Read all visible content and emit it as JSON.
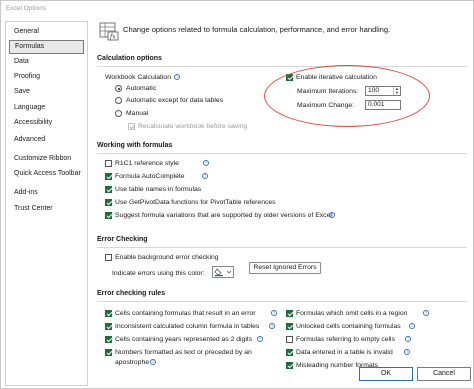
{
  "window": {
    "title": "Excel Options"
  },
  "sidebar": {
    "items": [
      {
        "label": "General"
      },
      {
        "label": "Formulas"
      },
      {
        "label": "Data"
      },
      {
        "label": "Proofing"
      },
      {
        "label": "Save"
      },
      {
        "label": "Language"
      },
      {
        "label": "Accessibility"
      },
      {
        "label": "Advanced"
      },
      {
        "label": "Customize Ribbon"
      },
      {
        "label": "Quick Access Toolbar"
      },
      {
        "label": "Add-ins"
      },
      {
        "label": "Trust Center"
      }
    ],
    "active_index": 1
  },
  "header": {
    "text": "Change options related to formula calculation, performance, and error handling."
  },
  "calculation_options": {
    "title": "Calculation options",
    "workbook_calc_label": "Workbook Calculation",
    "automatic": "Automatic",
    "automatic_except": "Automatic except for data tables",
    "manual": "Manual",
    "recalculate": "Recalculate workbook before saving",
    "enable_iterative": "Enable iterative calculation",
    "max_iterations_label": "Maximum Iterations:",
    "max_iterations_value": "100",
    "max_change_label": "Maximum Change:",
    "max_change_value": "0.001"
  },
  "working_with_formulas": {
    "title": "Working with formulas",
    "items": [
      {
        "label": "R1C1 reference style",
        "checked": false
      },
      {
        "label": "Formula AutoComplete",
        "checked": true
      },
      {
        "label": "Use table names in formulas",
        "checked": true
      },
      {
        "label": "Use GetPivotData functions for PivotTable references",
        "checked": true
      },
      {
        "label": "Suggest formula variations that are supported by older versions of Excel",
        "checked": true
      }
    ]
  },
  "error_checking": {
    "title": "Error Checking",
    "enable_background": "Enable background error checking",
    "indicate_label": "Indicate errors using this color:",
    "reset_button": "Reset Ignored Errors"
  },
  "error_checking_rules": {
    "title": "Error checking rules",
    "left": [
      {
        "label": "Cells containing formulas that result in an error",
        "checked": true
      },
      {
        "label": "Inconsistent calculated column formula in tables",
        "checked": true
      },
      {
        "label": "Cells containing years represented as 2 digits",
        "checked": true
      },
      {
        "label": "Numbers formatted as text or preceded by an",
        "label2": "apostrophe",
        "checked": true
      }
    ],
    "right": [
      {
        "label": "Formulas which omit cells in a region",
        "checked": true
      },
      {
        "label": "Unlocked cells containing formulas",
        "checked": true
      },
      {
        "label": "Formulas referring to empty cells",
        "checked": false
      },
      {
        "label": "Data entered in a table is invalid",
        "checked": true
      },
      {
        "label": "Misleading number formats",
        "checked": true
      }
    ]
  },
  "footer": {
    "ok": "OK",
    "cancel": "Cancel"
  },
  "colors": {
    "accent": "#1e6e3a",
    "annotation": "#e24b3b"
  }
}
